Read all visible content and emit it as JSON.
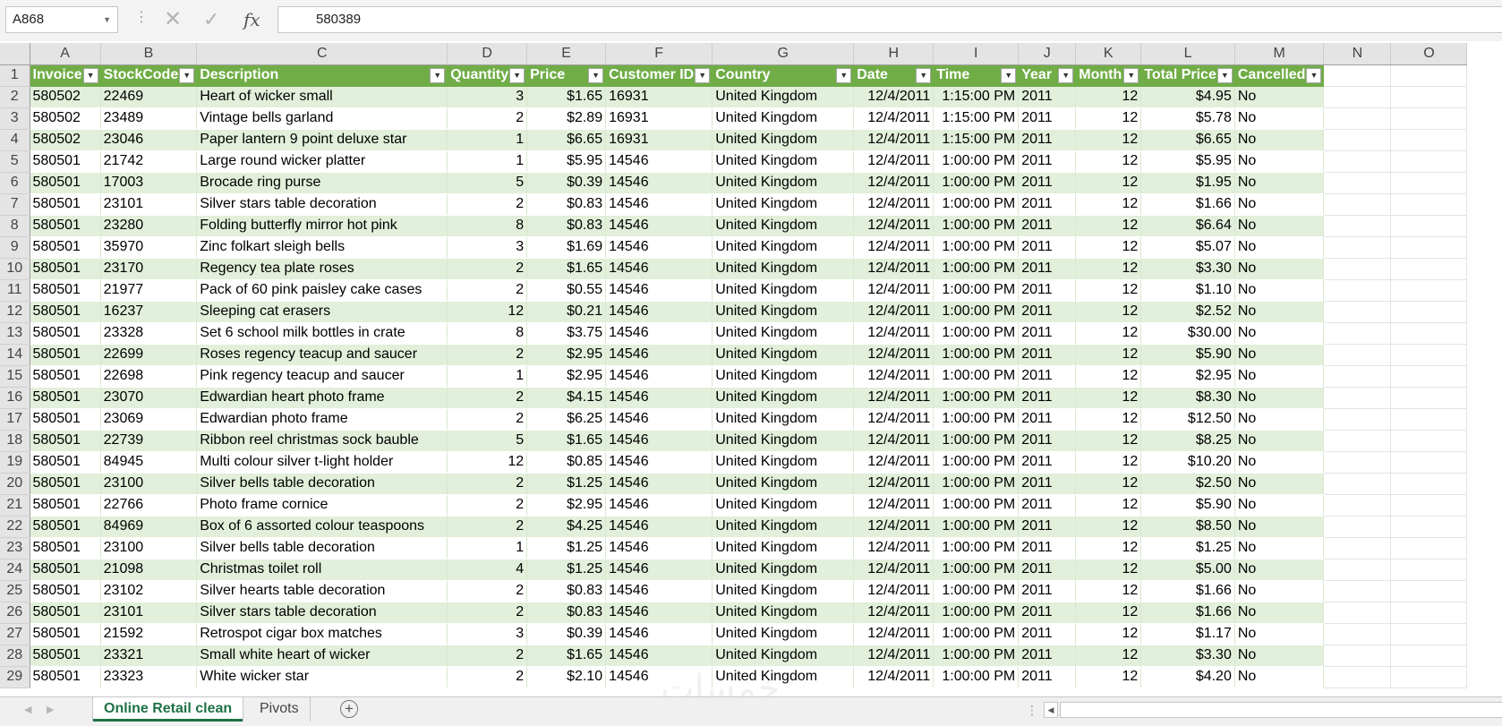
{
  "formula_bar": {
    "name_box": "A868",
    "cancel_icon": "✕",
    "enter_icon": "✓",
    "fx_label": "fx",
    "content": "580389"
  },
  "columns": [
    "A",
    "B",
    "C",
    "D",
    "E",
    "F",
    "G",
    "H",
    "I",
    "J",
    "K",
    "L",
    "M",
    "N",
    "O"
  ],
  "table": {
    "headers": [
      "Invoice",
      "StockCode",
      "Description",
      "Quantity",
      "Price",
      "Customer ID",
      "Country",
      "Date",
      "Time",
      "Year",
      "Month",
      "Total Price",
      "Cancelled"
    ],
    "rows": [
      [
        "580502",
        "22469",
        "Heart of wicker small",
        "3",
        "$1.65",
        "16931",
        "United Kingdom",
        "12/4/2011",
        "1:15:00 PM",
        "2011",
        "12",
        "$4.95",
        "No"
      ],
      [
        "580502",
        "23489",
        "Vintage bells garland",
        "2",
        "$2.89",
        "16931",
        "United Kingdom",
        "12/4/2011",
        "1:15:00 PM",
        "2011",
        "12",
        "$5.78",
        "No"
      ],
      [
        "580502",
        "23046",
        "Paper lantern 9 point deluxe star",
        "1",
        "$6.65",
        "16931",
        "United Kingdom",
        "12/4/2011",
        "1:15:00 PM",
        "2011",
        "12",
        "$6.65",
        "No"
      ],
      [
        "580501",
        "21742",
        "Large round wicker platter",
        "1",
        "$5.95",
        "14546",
        "United Kingdom",
        "12/4/2011",
        "1:00:00 PM",
        "2011",
        "12",
        "$5.95",
        "No"
      ],
      [
        "580501",
        "17003",
        "Brocade ring purse",
        "5",
        "$0.39",
        "14546",
        "United Kingdom",
        "12/4/2011",
        "1:00:00 PM",
        "2011",
        "12",
        "$1.95",
        "No"
      ],
      [
        "580501",
        "23101",
        "Silver stars table decoration",
        "2",
        "$0.83",
        "14546",
        "United Kingdom",
        "12/4/2011",
        "1:00:00 PM",
        "2011",
        "12",
        "$1.66",
        "No"
      ],
      [
        "580501",
        "23280",
        "Folding butterfly mirror hot pink",
        "8",
        "$0.83",
        "14546",
        "United Kingdom",
        "12/4/2011",
        "1:00:00 PM",
        "2011",
        "12",
        "$6.64",
        "No"
      ],
      [
        "580501",
        "35970",
        "Zinc folkart sleigh bells",
        "3",
        "$1.69",
        "14546",
        "United Kingdom",
        "12/4/2011",
        "1:00:00 PM",
        "2011",
        "12",
        "$5.07",
        "No"
      ],
      [
        "580501",
        "23170",
        "Regency tea plate roses",
        "2",
        "$1.65",
        "14546",
        "United Kingdom",
        "12/4/2011",
        "1:00:00 PM",
        "2011",
        "12",
        "$3.30",
        "No"
      ],
      [
        "580501",
        "21977",
        "Pack of 60 pink paisley cake cases",
        "2",
        "$0.55",
        "14546",
        "United Kingdom",
        "12/4/2011",
        "1:00:00 PM",
        "2011",
        "12",
        "$1.10",
        "No"
      ],
      [
        "580501",
        "16237",
        "Sleeping cat erasers",
        "12",
        "$0.21",
        "14546",
        "United Kingdom",
        "12/4/2011",
        "1:00:00 PM",
        "2011",
        "12",
        "$2.52",
        "No"
      ],
      [
        "580501",
        "23328",
        "Set 6 school milk bottles in crate",
        "8",
        "$3.75",
        "14546",
        "United Kingdom",
        "12/4/2011",
        "1:00:00 PM",
        "2011",
        "12",
        "$30.00",
        "No"
      ],
      [
        "580501",
        "22699",
        "Roses regency teacup and saucer",
        "2",
        "$2.95",
        "14546",
        "United Kingdom",
        "12/4/2011",
        "1:00:00 PM",
        "2011",
        "12",
        "$5.90",
        "No"
      ],
      [
        "580501",
        "22698",
        "Pink regency teacup and saucer",
        "1",
        "$2.95",
        "14546",
        "United Kingdom",
        "12/4/2011",
        "1:00:00 PM",
        "2011",
        "12",
        "$2.95",
        "No"
      ],
      [
        "580501",
        "23070",
        "Edwardian heart photo frame",
        "2",
        "$4.15",
        "14546",
        "United Kingdom",
        "12/4/2011",
        "1:00:00 PM",
        "2011",
        "12",
        "$8.30",
        "No"
      ],
      [
        "580501",
        "23069",
        "Edwardian photo frame",
        "2",
        "$6.25",
        "14546",
        "United Kingdom",
        "12/4/2011",
        "1:00:00 PM",
        "2011",
        "12",
        "$12.50",
        "No"
      ],
      [
        "580501",
        "22739",
        "Ribbon reel christmas sock bauble",
        "5",
        "$1.65",
        "14546",
        "United Kingdom",
        "12/4/2011",
        "1:00:00 PM",
        "2011",
        "12",
        "$8.25",
        "No"
      ],
      [
        "580501",
        "84945",
        "Multi colour silver t-light holder",
        "12",
        "$0.85",
        "14546",
        "United Kingdom",
        "12/4/2011",
        "1:00:00 PM",
        "2011",
        "12",
        "$10.20",
        "No"
      ],
      [
        "580501",
        "23100",
        "Silver bells table decoration",
        "2",
        "$1.25",
        "14546",
        "United Kingdom",
        "12/4/2011",
        "1:00:00 PM",
        "2011",
        "12",
        "$2.50",
        "No"
      ],
      [
        "580501",
        "22766",
        "Photo frame cornice",
        "2",
        "$2.95",
        "14546",
        "United Kingdom",
        "12/4/2011",
        "1:00:00 PM",
        "2011",
        "12",
        "$5.90",
        "No"
      ],
      [
        "580501",
        "84969",
        "Box of 6 assorted colour teaspoons",
        "2",
        "$4.25",
        "14546",
        "United Kingdom",
        "12/4/2011",
        "1:00:00 PM",
        "2011",
        "12",
        "$8.50",
        "No"
      ],
      [
        "580501",
        "23100",
        "Silver bells table decoration",
        "1",
        "$1.25",
        "14546",
        "United Kingdom",
        "12/4/2011",
        "1:00:00 PM",
        "2011",
        "12",
        "$1.25",
        "No"
      ],
      [
        "580501",
        "21098",
        "Christmas toilet roll",
        "4",
        "$1.25",
        "14546",
        "United Kingdom",
        "12/4/2011",
        "1:00:00 PM",
        "2011",
        "12",
        "$5.00",
        "No"
      ],
      [
        "580501",
        "23102",
        "Silver hearts table decoration",
        "2",
        "$0.83",
        "14546",
        "United Kingdom",
        "12/4/2011",
        "1:00:00 PM",
        "2011",
        "12",
        "$1.66",
        "No"
      ],
      [
        "580501",
        "23101",
        "Silver stars table decoration",
        "2",
        "$0.83",
        "14546",
        "United Kingdom",
        "12/4/2011",
        "1:00:00 PM",
        "2011",
        "12",
        "$1.66",
        "No"
      ],
      [
        "580501",
        "21592",
        "Retrospot cigar box matches",
        "3",
        "$0.39",
        "14546",
        "United Kingdom",
        "12/4/2011",
        "1:00:00 PM",
        "2011",
        "12",
        "$1.17",
        "No"
      ],
      [
        "580501",
        "23321",
        "Small white heart of wicker",
        "2",
        "$1.65",
        "14546",
        "United Kingdom",
        "12/4/2011",
        "1:00:00 PM",
        "2011",
        "12",
        "$3.30",
        "No"
      ],
      [
        "580501",
        "23323",
        "White wicker star",
        "2",
        "$2.10",
        "14546",
        "United Kingdom",
        "12/4/2011",
        "1:00:00 PM",
        "2011",
        "12",
        "$4.20",
        "No"
      ]
    ]
  },
  "sheet_tabs": [
    "Online Retail clean",
    "Pivots"
  ],
  "active_sheet": "Online Retail clean",
  "colors": {
    "header_green": "#70ad47",
    "band_green": "#e2efda",
    "active_tab_green": "#1e7145"
  }
}
